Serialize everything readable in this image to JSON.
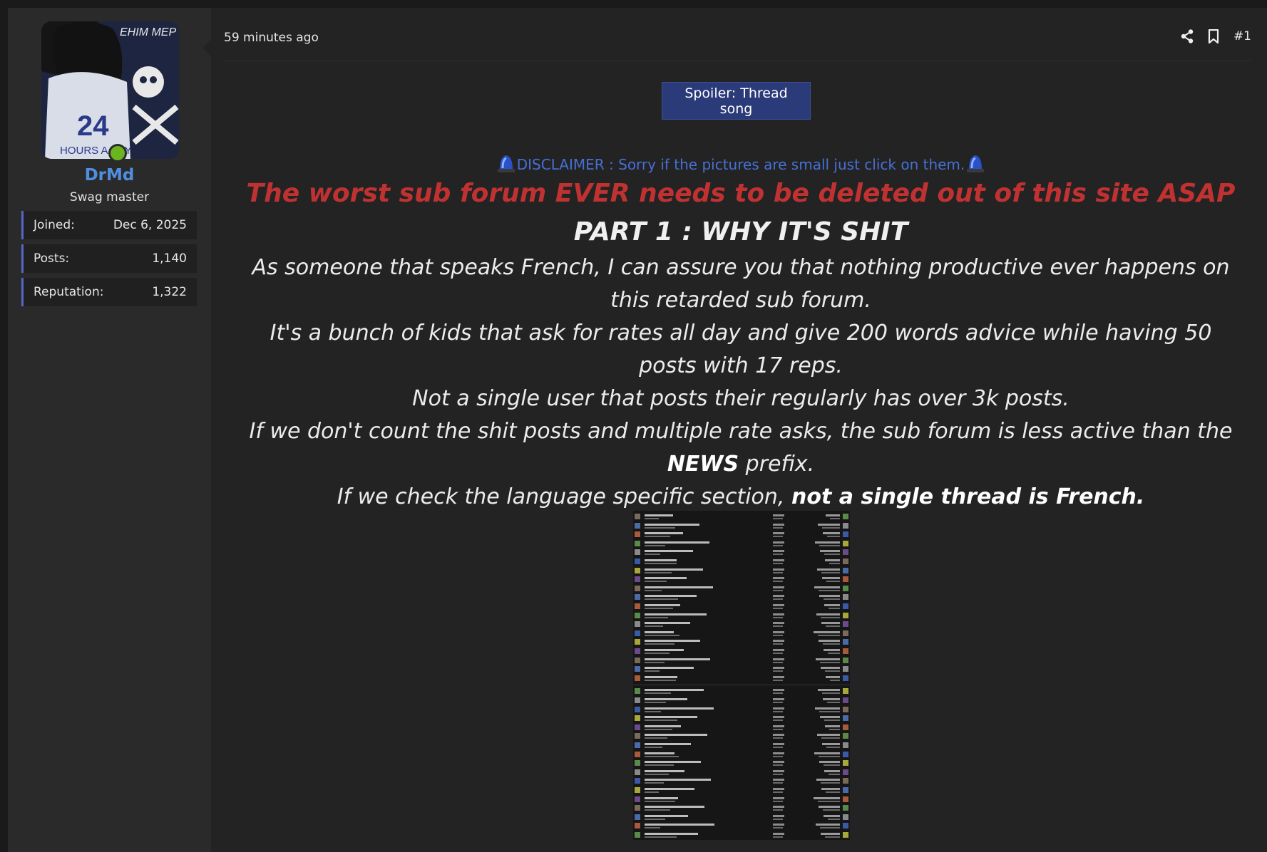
{
  "user": {
    "username": "DrMd",
    "user_title": "Swag master",
    "stats": [
      {
        "label": "Joined:",
        "value": "Dec 6, 2025"
      },
      {
        "label": "Posts:",
        "value": "1,140"
      },
      {
        "label": "Reputation:",
        "value": "1,322"
      }
    ],
    "online": true
  },
  "post": {
    "time": "59 minutes ago",
    "number": "#1",
    "actions": [
      "share-icon",
      "bookmark-icon"
    ],
    "spoiler_label": "Spoiler: Thread song",
    "disclaimer": "DISCLAIMER : Sorry if the pictures are small just click on them.",
    "headline": "The worst sub forum EVER needs to be deleted out of this site ASAP",
    "part_title": "PART 1 : WHY IT'S SHIT",
    "paragraphs": [
      {
        "text": "As someone that speaks French, I can assure you that nothing productive ever happens on this retarded sub forum."
      },
      {
        "text": "It's a bunch of kids that ask for rates all day and give 200 words advice while having 50 posts with 17 reps."
      },
      {
        "text": "Not a single user that posts their regularly has over 3k posts."
      },
      {
        "text_before": "If we don't count the shit posts and multiple rate asks, the sub forum is less active than the ",
        "bold": "NEWS",
        "text_after": " prefix."
      },
      {
        "text_before": "If we check the language specific section, ",
        "bold": "not a single thread is French.",
        "text_after": ""
      }
    ],
    "colors": {
      "accent": "#4e8fe0",
      "headline": "#c03232",
      "spoiler_bg": "#2b3a78",
      "disclaimer": "#4670d6",
      "online": "#6ab51e"
    }
  }
}
